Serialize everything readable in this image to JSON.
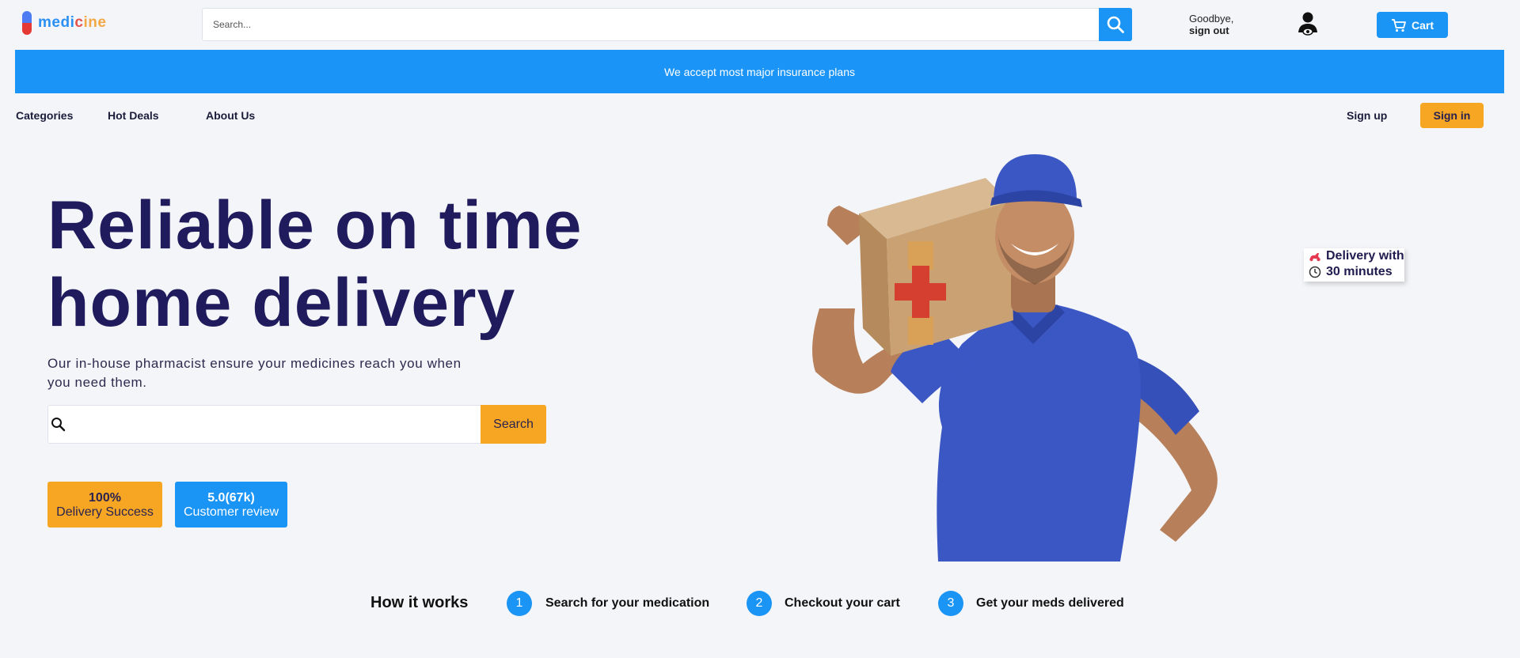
{
  "header": {
    "logo": {
      "part1": "medi",
      "part2": "c",
      "part3": "ine"
    },
    "search_placeholder": "Search...",
    "greeting": "Goodbye,",
    "signout": "sign out",
    "cart_label": "Cart"
  },
  "banner": {
    "text": "We accept most major insurance plans"
  },
  "nav": {
    "items": [
      {
        "label": "Categories"
      },
      {
        "label": "Hot Deals"
      },
      {
        "label": "About Us"
      }
    ],
    "signup": "Sign up",
    "signin": "Sign in"
  },
  "hero": {
    "title_line1": "Reliable on time",
    "title_line2": "home delivery",
    "subtitle": "Our in-house pharmacist ensure your medicines reach you when you need them.",
    "search_placeholder": "",
    "search_button": "Search",
    "stats": [
      {
        "value": "100%",
        "label": "Delivery Success"
      },
      {
        "value": "5.0(67k)",
        "label": "Customer review"
      }
    ],
    "badge": {
      "line1": "Delivery with",
      "line2": "30 minutes"
    }
  },
  "how_it_works": {
    "title": "How it works",
    "steps": [
      {
        "num": "1",
        "label": "Search for your medication"
      },
      {
        "num": "2",
        "label": "Checkout your cart"
      },
      {
        "num": "3",
        "label": "Get your meds delivered"
      }
    ]
  },
  "colors": {
    "primary": "#1a94f5",
    "accent": "#f6a623",
    "heading": "#1f1b5c",
    "background": "#f4f5f9"
  }
}
